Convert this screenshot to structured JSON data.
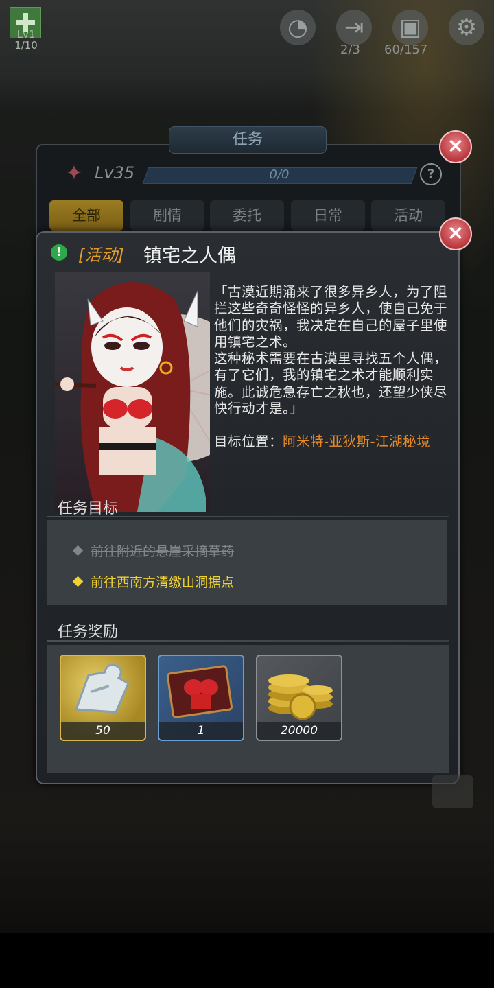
{
  "hud": {
    "level_label": "Lv1",
    "level_progress": "1/10",
    "stamina_count": "2/3",
    "bag_count": "60/157"
  },
  "quest_panel": {
    "title": "任务",
    "player_level": "Lv35",
    "exp_text": "0/0",
    "help_label": "?",
    "tabs": [
      "全部",
      "剧情",
      "委托",
      "日常",
      "活动"
    ],
    "active_tab": "全部"
  },
  "quest_detail": {
    "marker": "!",
    "type_label": "[活动]",
    "name": "镇宅之人偶",
    "description": "「古漠近期涌来了很多异乡人，为了阻拦这些奇奇怪怪的异乡人，使自己免于他们的灾祸，我决定在自己的屋子里使用镇宅之术。\n这种秘术需要在古漠里寻找五个人偶，有了它们，我的镇宅之术才能顺利实施。此诚危急存亡之秋也，还望少侠尽快行动才是。」",
    "target_label": "目标位置：",
    "target_value": "阿米特-亚狄斯-江湖秘境",
    "objectives_title": "任务目标",
    "objectives": [
      {
        "text": "前往附近的悬崖采摘草药",
        "done": true
      },
      {
        "text": "前往西南方清缴山洞据点",
        "done": false
      }
    ],
    "rewards_title": "任务奖励",
    "rewards": [
      {
        "icon": "puzzle-piece-icon",
        "count": "50"
      },
      {
        "icon": "outfit-chest-icon",
        "count": "1"
      },
      {
        "icon": "gold-coins-icon",
        "count": "20000"
      }
    ]
  },
  "colors": {
    "accent_gold": "#9a7c22",
    "quest_type": "#e59d2a",
    "target_location": "#e58a2a",
    "active_objective": "#f0d230",
    "close_button": "#b8373d"
  }
}
